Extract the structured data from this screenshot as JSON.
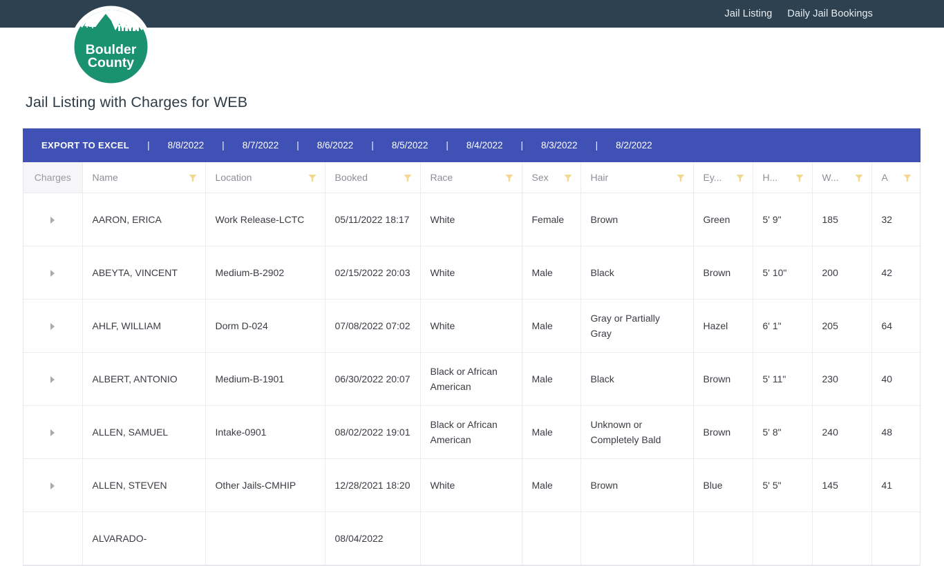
{
  "topnav": {
    "items": [
      {
        "label": "Jail Listing",
        "name": "nav-jail-listing"
      },
      {
        "label": "Daily Jail Bookings",
        "name": "nav-daily-jail-bookings"
      }
    ]
  },
  "logo": {
    "line1": "Boulder",
    "line2": "County",
    "icon": "boulder-county-logo",
    "color": "#1a9171"
  },
  "page": {
    "title": "Jail Listing with Charges for WEB"
  },
  "toolbar": {
    "accent_color": "#3f51b5",
    "export_label": "EXPORT TO EXCEL",
    "separator": "|",
    "dates": [
      "8/8/2022",
      "8/7/2022",
      "8/6/2022",
      "8/5/2022",
      "8/4/2022",
      "8/3/2022",
      "8/2/2022"
    ]
  },
  "grid": {
    "filter_icon": "filter-funnel-icon",
    "filter_color": "#f5d98a",
    "expander_icon": "expand-row-triangle-icon",
    "columns": [
      {
        "label": "Charges",
        "filter": false
      },
      {
        "label": "Name",
        "filter": true
      },
      {
        "label": "Location",
        "filter": true
      },
      {
        "label": "Booked",
        "filter": true
      },
      {
        "label": "Race",
        "filter": true
      },
      {
        "label": "Sex",
        "filter": true
      },
      {
        "label": "Hair",
        "filter": true
      },
      {
        "label": "Ey...",
        "filter": true
      },
      {
        "label": "H...",
        "filter": true
      },
      {
        "label": "W...",
        "filter": true
      },
      {
        "label": "A",
        "filter": true
      }
    ],
    "rows": [
      {
        "name": "AARON, ERICA",
        "location": "Work Release-LCTC",
        "booked": "05/11/2022 18:17",
        "race": "White",
        "sex": "Female",
        "hair": "Brown",
        "eyes": "Green",
        "height": "5' 9\"",
        "weight": "185",
        "age": "32"
      },
      {
        "name": "ABEYTA, VINCENT",
        "location": "Medium-B-2902",
        "booked": "02/15/2022 20:03",
        "race": "White",
        "sex": "Male",
        "hair": "Black",
        "eyes": "Brown",
        "height": "5' 10\"",
        "weight": "200",
        "age": "42"
      },
      {
        "name": "AHLF, WILLIAM",
        "location": "Dorm D-024",
        "booked": "07/08/2022 07:02",
        "race": "White",
        "sex": "Male",
        "hair": "Gray or Partially Gray",
        "eyes": "Hazel",
        "height": "6' 1\"",
        "weight": "205",
        "age": "64"
      },
      {
        "name": "ALBERT, ANTONIO",
        "location": "Medium-B-1901",
        "booked": "06/30/2022 20:07",
        "race": "Black or African American",
        "sex": "Male",
        "hair": "Black",
        "eyes": "Brown",
        "height": "5' 11\"",
        "weight": "230",
        "age": "40"
      },
      {
        "name": "ALLEN, SAMUEL",
        "location": "Intake-0901",
        "booked": "08/02/2022 19:01",
        "race": "Black or African American",
        "sex": "Male",
        "hair": "Unknown or Completely Bald",
        "eyes": "Brown",
        "height": "5' 8\"",
        "weight": "240",
        "age": "48"
      },
      {
        "name": "ALLEN, STEVEN",
        "location": "Other Jails-CMHIP",
        "booked": "12/28/2021 18:20",
        "race": "White",
        "sex": "Male",
        "hair": "Brown",
        "eyes": "Blue",
        "height": "5' 5\"",
        "weight": "145",
        "age": "41"
      },
      {
        "name": "ALVARADO-",
        "location": "",
        "booked": "08/04/2022",
        "race": "",
        "sex": "",
        "hair": "",
        "eyes": "",
        "height": "",
        "weight": "",
        "age": ""
      }
    ]
  }
}
